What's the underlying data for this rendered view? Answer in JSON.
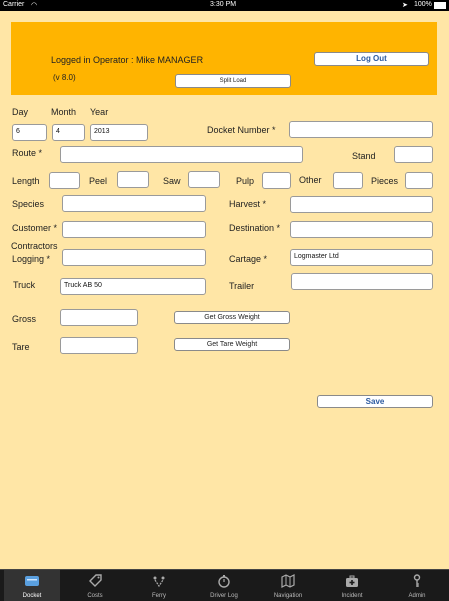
{
  "status": {
    "carrier": "Carrier",
    "time": "3:30 PM",
    "battery": "100%"
  },
  "header": {
    "logged_in": "Logged in Operator : Mike MANAGER",
    "version": "(v 8.0)",
    "logout": "Log Out",
    "split_load": "Split Load"
  },
  "labels": {
    "day": "Day",
    "month": "Month",
    "year": "Year",
    "docket_number": "Docket Number *",
    "route": "Route *",
    "stand": "Stand",
    "length": "Length",
    "peel": "Peel",
    "saw": "Saw",
    "pulp": "Pulp",
    "other": "Other",
    "pieces": "Pieces",
    "species": "Species",
    "harvest": "Harvest *",
    "customer": "Customer *",
    "destination": "Destination *",
    "contractors": "Contractors",
    "logging": "Logging *",
    "cartage": "Cartage *",
    "truck": "Truck",
    "trailer": "Trailer",
    "gross": "Gross",
    "tare": "Tare"
  },
  "values": {
    "day": "6",
    "month": "4",
    "year": "2013",
    "docket_number": "",
    "route": "",
    "stand": "",
    "length": "",
    "peel": "",
    "saw": "",
    "pulp": "",
    "other": "",
    "pieces": "",
    "species": "",
    "harvest": "",
    "customer": "",
    "destination": "",
    "logging": "",
    "cartage": "Logmaster Ltd",
    "truck": "Truck AB 50",
    "trailer": "",
    "gross": "",
    "tare": ""
  },
  "buttons": {
    "get_gross": "Get Gross Weight",
    "get_tare": "Get Tare Weight",
    "save": "Save"
  },
  "tabs": [
    {
      "label": "Docket",
      "icon": "docket-icon"
    },
    {
      "label": "Costs",
      "icon": "tag-icon"
    },
    {
      "label": "Ferry",
      "icon": "ferry-icon"
    },
    {
      "label": "Driver Log",
      "icon": "stopwatch-icon"
    },
    {
      "label": "Navigation",
      "icon": "map-icon"
    },
    {
      "label": "Incident",
      "icon": "first-aid-icon"
    },
    {
      "label": "Admin",
      "icon": "key-icon"
    }
  ],
  "active_tab": "Docket",
  "colors": {
    "background": "#ffe6a6",
    "header": "#ffb400",
    "button_text": "#2c5aa0"
  }
}
